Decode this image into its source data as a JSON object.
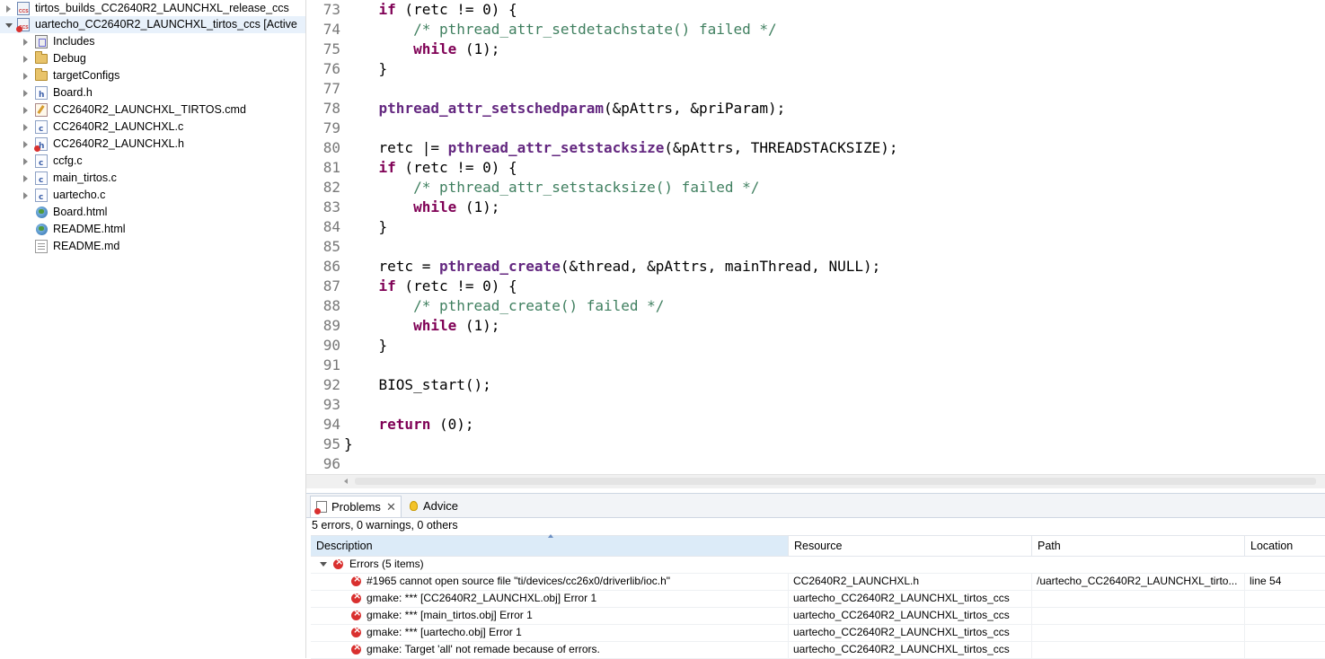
{
  "explorer": {
    "items": [
      {
        "label": "tirtos_builds_CC2640R2_LAUNCHXL_release_ccs",
        "icon": "ccs-project-icon",
        "twisty": "closed"
      },
      {
        "label": "uartecho_CC2640R2_LAUNCHXL_tirtos_ccs  [Active",
        "icon": "ccs-project-error-icon",
        "twisty": "open"
      },
      {
        "label": "Includes",
        "icon": "includes-icon",
        "twisty": "closed"
      },
      {
        "label": "Debug",
        "icon": "folder-icon",
        "twisty": "closed"
      },
      {
        "label": "targetConfigs",
        "icon": "folder-icon",
        "twisty": "closed"
      },
      {
        "label": "Board.h",
        "icon": "header-file-icon",
        "twisty": "closed"
      },
      {
        "label": "CC2640R2_LAUNCHXL_TIRTOS.cmd",
        "icon": "cmd-file-icon",
        "twisty": "closed"
      },
      {
        "label": "CC2640R2_LAUNCHXL.c",
        "icon": "c-file-icon",
        "twisty": "closed"
      },
      {
        "label": "CC2640R2_LAUNCHXL.h",
        "icon": "header-file-error-icon",
        "twisty": "closed"
      },
      {
        "label": "ccfg.c",
        "icon": "c-file-icon",
        "twisty": "closed"
      },
      {
        "label": "main_tirtos.c",
        "icon": "c-file-icon",
        "twisty": "closed"
      },
      {
        "label": "uartecho.c",
        "icon": "c-file-icon",
        "twisty": "closed"
      },
      {
        "label": "Board.html",
        "icon": "html-file-icon",
        "twisty": "none"
      },
      {
        "label": "README.html",
        "icon": "html-file-icon",
        "twisty": "none"
      },
      {
        "label": "README.md",
        "icon": "text-file-icon",
        "twisty": "none"
      }
    ]
  },
  "editor": {
    "lines": [
      {
        "n": "73",
        "text": "    if (retc != 0) {"
      },
      {
        "n": "74",
        "text": "        /* pthread_attr_setdetachstate() failed */"
      },
      {
        "n": "75",
        "text": "        while (1);"
      },
      {
        "n": "76",
        "text": "    }"
      },
      {
        "n": "77",
        "text": ""
      },
      {
        "n": "78",
        "text": "    pthread_attr_setschedparam(&pAttrs, &priParam);"
      },
      {
        "n": "79",
        "text": ""
      },
      {
        "n": "80",
        "text": "    retc |= pthread_attr_setstacksize(&pAttrs, THREADSTACKSIZE);"
      },
      {
        "n": "81",
        "text": "    if (retc != 0) {"
      },
      {
        "n": "82",
        "text": "        /* pthread_attr_setstacksize() failed */"
      },
      {
        "n": "83",
        "text": "        while (1);"
      },
      {
        "n": "84",
        "text": "    }"
      },
      {
        "n": "85",
        "text": ""
      },
      {
        "n": "86",
        "text": "    retc = pthread_create(&thread, &pAttrs, mainThread, NULL);"
      },
      {
        "n": "87",
        "text": "    if (retc != 0) {"
      },
      {
        "n": "88",
        "text": "        /* pthread_create() failed */"
      },
      {
        "n": "89",
        "text": "        while (1);"
      },
      {
        "n": "90",
        "text": "    }"
      },
      {
        "n": "91",
        "text": ""
      },
      {
        "n": "92",
        "text": "    BIOS_start();"
      },
      {
        "n": "93",
        "text": ""
      },
      {
        "n": "94",
        "text": "    return (0);"
      },
      {
        "n": "95",
        "text": "}"
      },
      {
        "n": "96",
        "text": ""
      }
    ]
  },
  "problems": {
    "tabs": {
      "problems": "Problems",
      "advice": "Advice",
      "close": "✕"
    },
    "summary": "5 errors, 0 warnings, 0 others",
    "columns": {
      "description": "Description",
      "resource": "Resource",
      "path": "Path",
      "location": "Location"
    },
    "group": "Errors (5 items)",
    "rows": [
      {
        "description": "#1965 cannot open source file \"ti/devices/cc26x0/driverlib/ioc.h\"",
        "resource": "CC2640R2_LAUNCHXL.h",
        "path": "/uartecho_CC2640R2_LAUNCHXL_tirto...",
        "location": "line 54"
      },
      {
        "description": "gmake: *** [CC2640R2_LAUNCHXL.obj] Error 1",
        "resource": "uartecho_CC2640R2_LAUNCHXL_tirtos_ccs",
        "path": "",
        "location": ""
      },
      {
        "description": "gmake: *** [main_tirtos.obj] Error 1",
        "resource": "uartecho_CC2640R2_LAUNCHXL_tirtos_ccs",
        "path": "",
        "location": ""
      },
      {
        "description": "gmake: *** [uartecho.obj] Error 1",
        "resource": "uartecho_CC2640R2_LAUNCHXL_tirtos_ccs",
        "path": "",
        "location": ""
      },
      {
        "description": "gmake: Target 'all' not remade because of errors.",
        "resource": "uartecho_CC2640R2_LAUNCHXL_tirtos_ccs",
        "path": "",
        "location": ""
      }
    ]
  }
}
